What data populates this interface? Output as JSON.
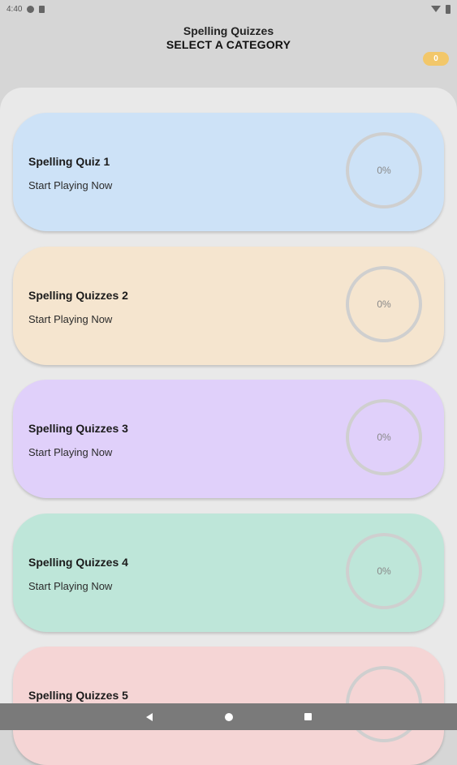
{
  "status_bar": {
    "time": "4:40"
  },
  "header": {
    "title": "Spelling Quizzes",
    "subtitle": "SELECT A CATEGORY"
  },
  "coin_badge": {
    "value": "0"
  },
  "cards": [
    {
      "title": "Spelling Quiz 1",
      "subtitle": "Start Playing Now",
      "progress": "0%",
      "color": "#cde2f7"
    },
    {
      "title": "Spelling Quizzes 2",
      "subtitle": "Start Playing Now",
      "progress": "0%",
      "color": "#f5e5cf"
    },
    {
      "title": "Spelling Quizzes 3",
      "subtitle": "Start Playing Now",
      "progress": "0%",
      "color": "#e0d0fa"
    },
    {
      "title": "Spelling Quizzes 4",
      "subtitle": "Start Playing Now",
      "progress": "0%",
      "color": "#bee6d9"
    },
    {
      "title": "Spelling Quizzes 5",
      "subtitle": "",
      "progress": "",
      "color": "#f5d5d5"
    }
  ],
  "icons": {
    "back": "back-icon",
    "home": "home-icon",
    "recents": "recents-icon"
  }
}
